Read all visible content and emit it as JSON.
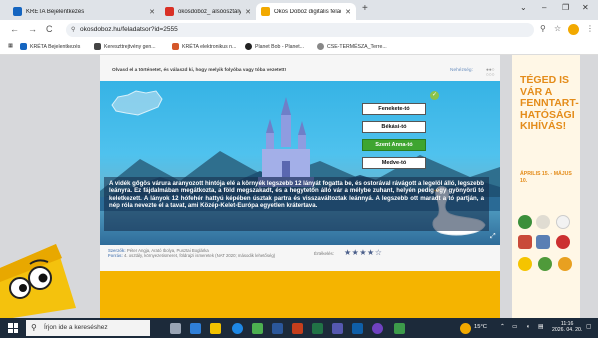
{
  "browser": {
    "tabs": [
      {
        "title": "KRÉTA Bejelentkezés",
        "favicon_color": "#1565c0",
        "active": false
      },
      {
        "title": "okosdoboz_ alsóosztályos@g...",
        "favicon_color": "#d93025",
        "active": false
      },
      {
        "title": "Okos Doboz digitális feladatgy...",
        "favicon_color": "#f2a900",
        "active": true
      }
    ],
    "new_tab": "+",
    "window_controls": {
      "collapse": "⌄",
      "minimize": "–",
      "maximize": "❐",
      "close": "✕"
    }
  },
  "address_bar": {
    "back": "←",
    "forward": "→",
    "reload": "C",
    "url": "okosdoboz.hu/feladatsor?id=2555",
    "icons": [
      "zoom-icon",
      "star-icon",
      "profile-avatar",
      "menu-icon"
    ]
  },
  "bookmarks": [
    {
      "label": "KRÉTA Bejelentkezés",
      "color": "#1565c0"
    },
    {
      "label": "Kereszttrejtvény gen...",
      "color": "#444444"
    },
    {
      "label": "KRÉTA elektronikus n...",
      "color": "#d4572a"
    },
    {
      "label": "Planet Bob - Planet...",
      "color": "#222222"
    },
    {
      "label": "CSE-TERMÉSZA_Terre...",
      "color": "#888888"
    }
  ],
  "exercise": {
    "instruction": "Olvasd el a történetet, és válaszd ki, hogy melyik folyóba vagy tóba vezetett!",
    "difficulty": "Nehézség:",
    "answers": [
      {
        "label": "Fenekete-tó",
        "correct": false
      },
      {
        "label": "Békási-tó",
        "correct": false
      },
      {
        "label": "Szent Anna-tó",
        "correct": true
      },
      {
        "label": "Medve-tó",
        "correct": false
      }
    ],
    "ok_mark": "✓",
    "story": "A vidék gőgös várura aranyozott hintója elé a környék legszebb 12 lányát fogatta be, és ostorával rávágott a legelöl álló, legszebb leányra. Ez fájdalmában megátkozta, a föld megszakadt, és a hegytetőn álló vár a mélybe zuhant, helyén pedig egy gyönyörű tó keletkezett. A lányok 12 hófehér hattyú képében úsztak partra és visszaváltoztak leánnyá. A legszebb ott maradt a tó partján, a nép róla nevezte el a tavat, ami Közép-Kelet-Európa egyetlen krátertava.",
    "expand_icon": "⤢",
    "meta": {
      "authors_label": "Szerzők:",
      "authors": "Péter Angja, Arató Ibolya, Pusztai Boglárka",
      "source_label": "Forrás:",
      "source": "4. osztály, környezetismeret, földrajzi ismeretek (NAT 2020; második lehetőség)"
    },
    "rating_label": "Értékelés:",
    "stars": "★★★★☆"
  },
  "ad": {
    "headline": "TÉGED IS VÁR A FENNTART-HATÓSÁGI KIHÍVÁS!",
    "dates": "ÁPRILIS 15. - MÁJUS 10."
  },
  "taskbar": {
    "search_placeholder": "Írjon ide a kereséshez",
    "temperature": "15°C",
    "time": "11:16",
    "date": "2026. 04. 20."
  }
}
